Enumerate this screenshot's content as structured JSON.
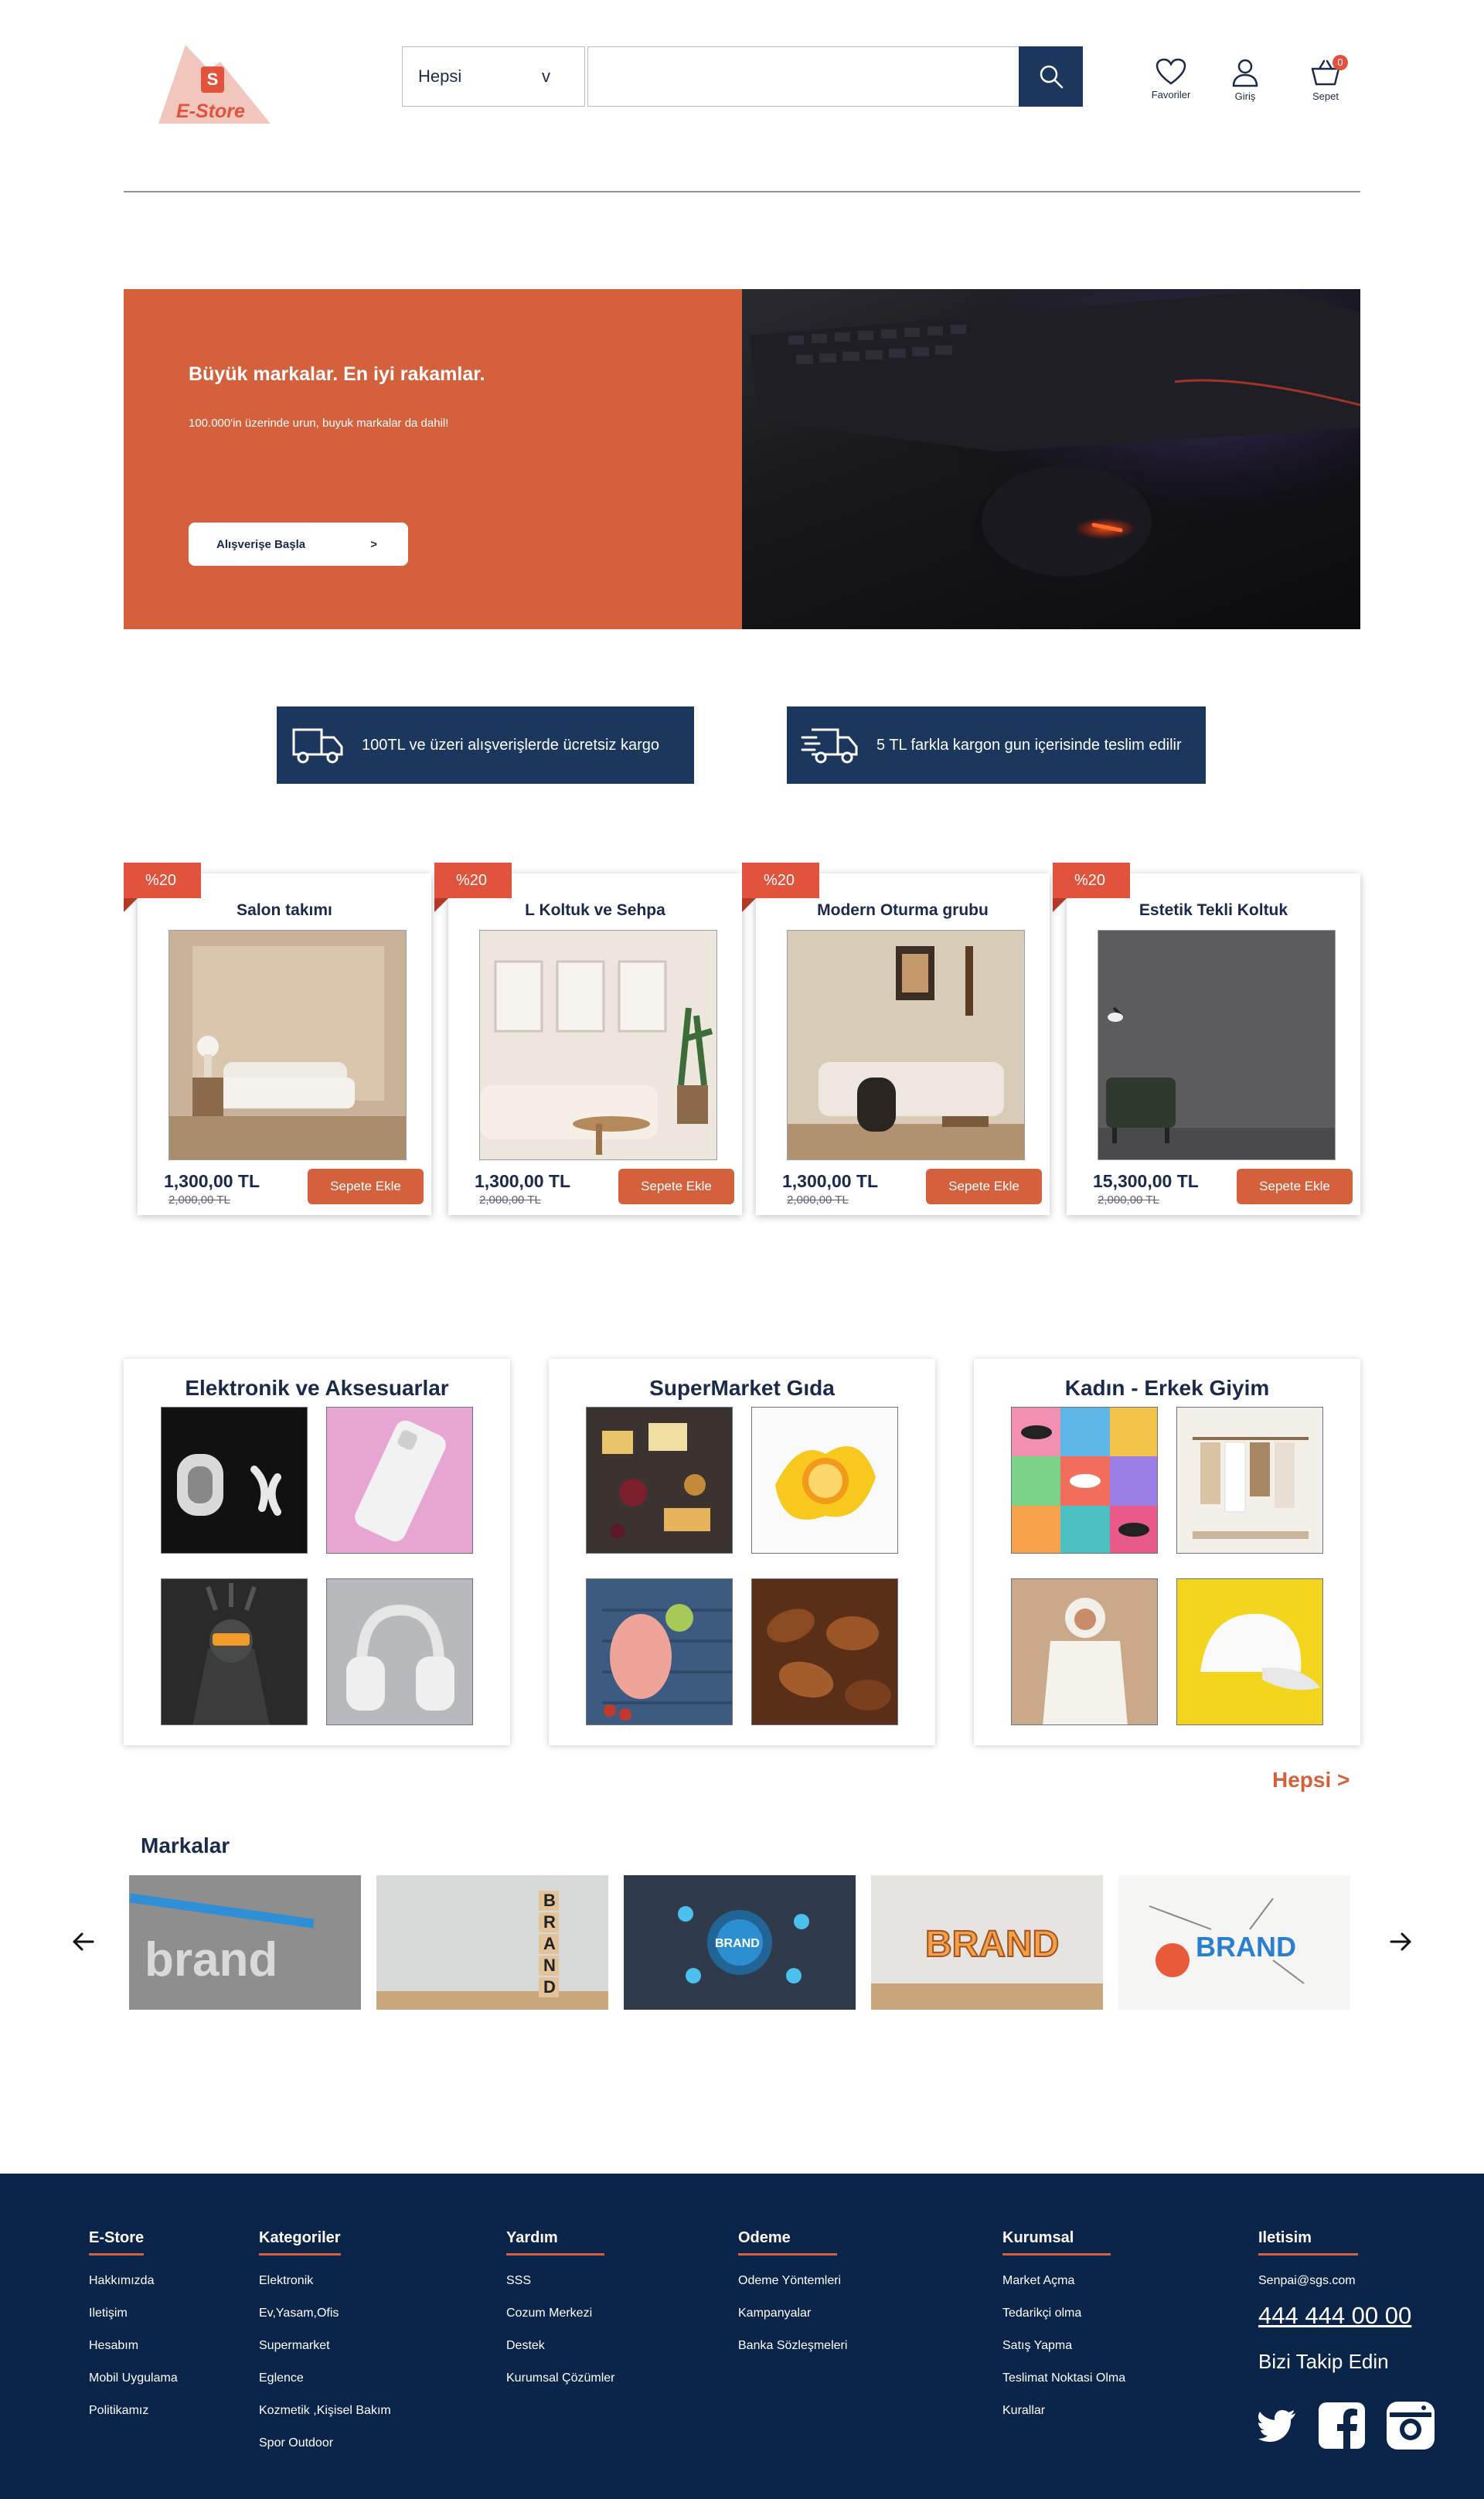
{
  "header": {
    "logo_text": "E-Store",
    "logo_badge": "S",
    "search_category": "Hepsi",
    "search_chevron": "v",
    "search_placeholder": "",
    "favorites_label": "Favoriler",
    "login_label": "Giriş",
    "cart_label": "Sepet",
    "cart_count": "0"
  },
  "hero": {
    "title": "Büyük markalar. En iyi rakamlar.",
    "subtitle": "100.000'in üzerinde urun, buyuk markalar da dahil!",
    "cta_label": "Alışverişe Başla",
    "cta_arrow": ">"
  },
  "shipping": [
    {
      "icon": "truck-icon",
      "text": "100TL ve üzeri alışverişlerde ücretsiz kargo"
    },
    {
      "icon": "fast-truck-icon",
      "text": "5 TL farkla kargon gun içerisinde teslim edilir"
    }
  ],
  "products": [
    {
      "badge": "%20",
      "name": "Salon takımı",
      "price": "1,300,00 TL",
      "old_price": "2,000,00 TL",
      "cart_label": "Sepete Ekle"
    },
    {
      "badge": "%20",
      "name": "L Koltuk ve Sehpa",
      "price": "1,300,00 TL",
      "old_price": "2,000,00 TL",
      "cart_label": "Sepete Ekle"
    },
    {
      "badge": "%20",
      "name": "Modern Oturma grubu",
      "price": "1,300,00 TL",
      "old_price": "2,000,00 TL",
      "cart_label": "Sepete Ekle"
    },
    {
      "badge": "%20",
      "name": "Estetik Tekli Koltuk",
      "price": "15,300,00 TL",
      "old_price": "2,000,00 TL",
      "cart_label": "Sepete Ekle"
    }
  ],
  "categories": [
    {
      "title": "Elektronik ve Aksesuarlar"
    },
    {
      "title": "SuperMarket Gıda"
    },
    {
      "title": "Kadın - Erkek Giyim"
    }
  ],
  "all_link": "Hepsi >",
  "brands": {
    "title": "Markalar",
    "items": [
      "brand",
      "BRAND",
      "BRAND",
      "BRAND",
      "BRAND"
    ]
  },
  "footer": {
    "columns": [
      {
        "title": "E-Store",
        "items": [
          "Hakkımızda",
          "Iletişim",
          "Hesabım",
          "Mobil Uygulama",
          "Politikamız"
        ]
      },
      {
        "title": "Kategoriler",
        "items": [
          "Elektronik",
          "Ev,Yasam,Ofis",
          "Supermarket",
          "Eglence",
          "Kozmetik ,Kişisel Bakım",
          "Spor Outdoor"
        ]
      },
      {
        "title": "Yardım",
        "items": [
          "SSS",
          "Cozum Merkezi",
          "Destek",
          "Kurumsal Çözümler"
        ]
      },
      {
        "title": "Odeme",
        "items": [
          "Odeme Yöntemleri",
          "Kampanyalar",
          "Banka Sözleşmeleri"
        ]
      },
      {
        "title": "Kurumsal",
        "items": [
          "Market Açma",
          "Tedarikçi olma",
          "Satış Yapma",
          "Teslimat Noktasi Olma",
          "Kurallar"
        ]
      }
    ],
    "contact": {
      "title": "Iletisim",
      "email": "Senpai@sgs.com",
      "phone": "444 444 00 00",
      "follow": "Bizi Takip Edin"
    }
  },
  "colors": {
    "accent": "#d5603c",
    "navy": "#1c375d",
    "footer_bg": "#0b2449",
    "badge": "#e1533d"
  }
}
